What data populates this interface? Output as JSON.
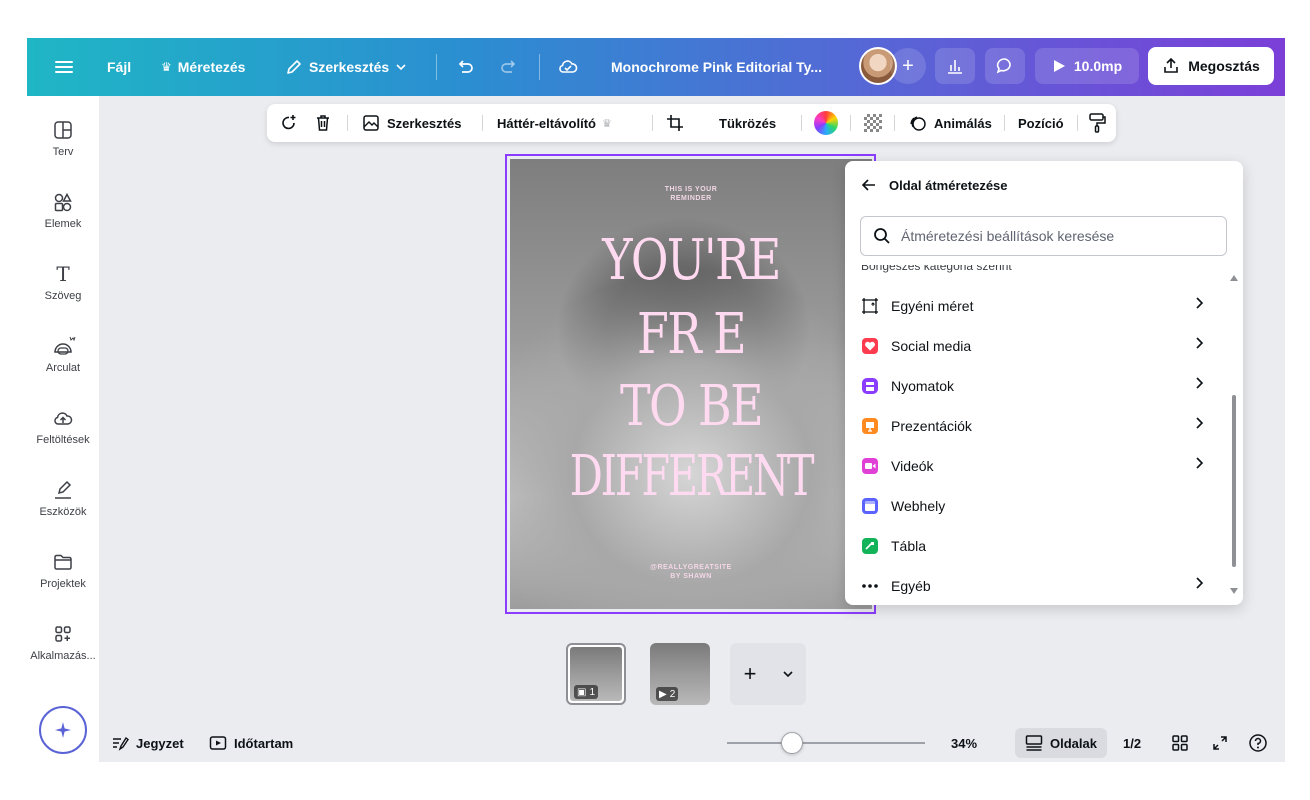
{
  "topbar": {
    "file_label": "Fájl",
    "resize_label": "Méretezés",
    "edit_label": "Szerkesztés",
    "doc_title": "Monochrome Pink Editorial Ty...",
    "duration_label": "10.0mp",
    "share_label": "Megosztás",
    "crown_icon": "crown-icon"
  },
  "sidebar": {
    "items": [
      {
        "label": "Terv",
        "icon": "layout-icon"
      },
      {
        "label": "Elemek",
        "icon": "shapes-icon"
      },
      {
        "label": "Szöveg",
        "icon": "text-icon"
      },
      {
        "label": "Arculat",
        "icon": "brand-icon"
      },
      {
        "label": "Feltöltések",
        "icon": "upload-icon"
      },
      {
        "label": "Eszközök",
        "icon": "draw-icon"
      },
      {
        "label": "Projektek",
        "icon": "folder-icon"
      },
      {
        "label": "Alkalmazás...",
        "icon": "apps-icon"
      }
    ]
  },
  "context_toolbar": {
    "edit_label": "Szerkesztés",
    "bg_remover_label": "Háttér-eltávolító",
    "flip_label": "Tükrözés",
    "animate_label": "Animálás",
    "position_label": "Pozíció"
  },
  "design": {
    "reminder_line1": "THIS IS YOUR",
    "reminder_line2": "REMINDER",
    "line1": "YOU'RE",
    "line2": "FR  E",
    "line3": "TO BE",
    "line4": "DIFFERENT",
    "site_line1": "@REALLYGREATSITE",
    "site_line2": "BY SHAWN"
  },
  "resize_panel": {
    "title": "Oldal átméretezése",
    "search_placeholder": "Átméretezési beállítások keresése",
    "category_heading": "Böngészés kategória szerint",
    "items": [
      {
        "label": "Egyéni méret",
        "icon": "custom-size-icon",
        "color": "#0d1216",
        "has_chevron": true
      },
      {
        "label": "Social media",
        "icon": "heart-icon",
        "color": "#ff3b4f",
        "has_chevron": true
      },
      {
        "label": "Nyomatok",
        "icon": "printer-icon",
        "color": "#8b3dff",
        "has_chevron": true
      },
      {
        "label": "Prezentációk",
        "icon": "presentation-icon",
        "color": "#ff8a1f",
        "has_chevron": true
      },
      {
        "label": "Videók",
        "icon": "video-icon",
        "color": "#e040d6",
        "has_chevron": true
      },
      {
        "label": "Webhely",
        "icon": "website-icon",
        "color": "#5a63ff",
        "has_chevron": false
      },
      {
        "label": "Tábla",
        "icon": "whiteboard-icon",
        "color": "#13b35a",
        "has_chevron": false
      },
      {
        "label": "Egyéb",
        "icon": "more-icon",
        "color": "#0d1216",
        "has_chevron": true
      }
    ]
  },
  "thumbnails": [
    {
      "number": "1"
    },
    {
      "number": "2"
    }
  ],
  "bottombar": {
    "notes_label": "Jegyzet",
    "timing_label": "Időtartam",
    "zoom_label": "34%",
    "zoom_value": 0.34,
    "pages_label": "Oldalak",
    "page_count": "1/2"
  }
}
